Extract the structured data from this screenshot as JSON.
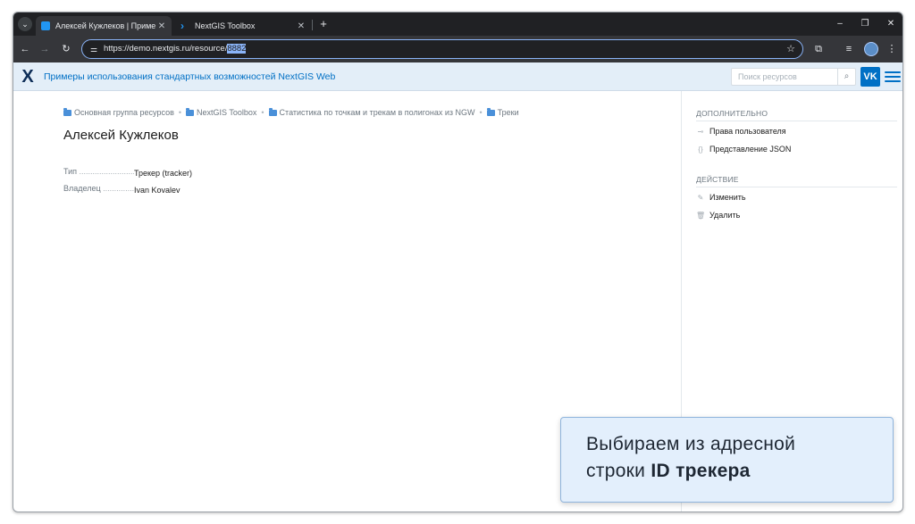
{
  "browser": {
    "tabs": [
      {
        "title": "Алексей Кужлеков | Примеры",
        "active": true,
        "close": "✕"
      },
      {
        "title": "NextGIS Toolbox",
        "active": false,
        "close": "✕"
      }
    ],
    "new_tab": "+",
    "address": {
      "url_prefix": "https://demo.nextgis.ru/resource/",
      "url_selected": "8882"
    },
    "window_controls": {
      "minimize": "–",
      "maximize": "❐",
      "close": "✕"
    }
  },
  "app": {
    "logo": "X",
    "title": "Примеры использования стандартных возможностей NextGIS Web",
    "search_placeholder": "Поиск ресурсов",
    "avatar": "VK"
  },
  "breadcrumb": [
    "Основная группа ресурсов",
    "NextGIS Toolbox",
    "Статистика по точкам и трекам в полигонах из NGW",
    "Треки"
  ],
  "page": {
    "title": "Алексей Кужлеков",
    "properties": [
      {
        "key": "Тип",
        "value": "Трекер (tracker)"
      },
      {
        "key": "Владелец",
        "value": "Ivan Kovalev"
      }
    ]
  },
  "sidebar": {
    "extra_heading": "ДОПОЛНИТЕЛЬНО",
    "extra_items": [
      {
        "label": "Права пользователя",
        "icon": "key-icon"
      },
      {
        "label": "Представление JSON",
        "icon": "code-icon"
      }
    ],
    "action_heading": "ДЕЙСТВИЕ",
    "action_items": [
      {
        "label": "Изменить",
        "icon": "pencil-icon"
      },
      {
        "label": "Удалить",
        "icon": "trash-icon"
      }
    ]
  },
  "callout": {
    "line1": "Выбираем из адресной",
    "line2_plain": "строки ",
    "line2_bold": "ID трекера"
  },
  "colors": {
    "accent": "#0070c5",
    "header_bg": "#e3eef8",
    "callout_bg": "#e3effc"
  }
}
